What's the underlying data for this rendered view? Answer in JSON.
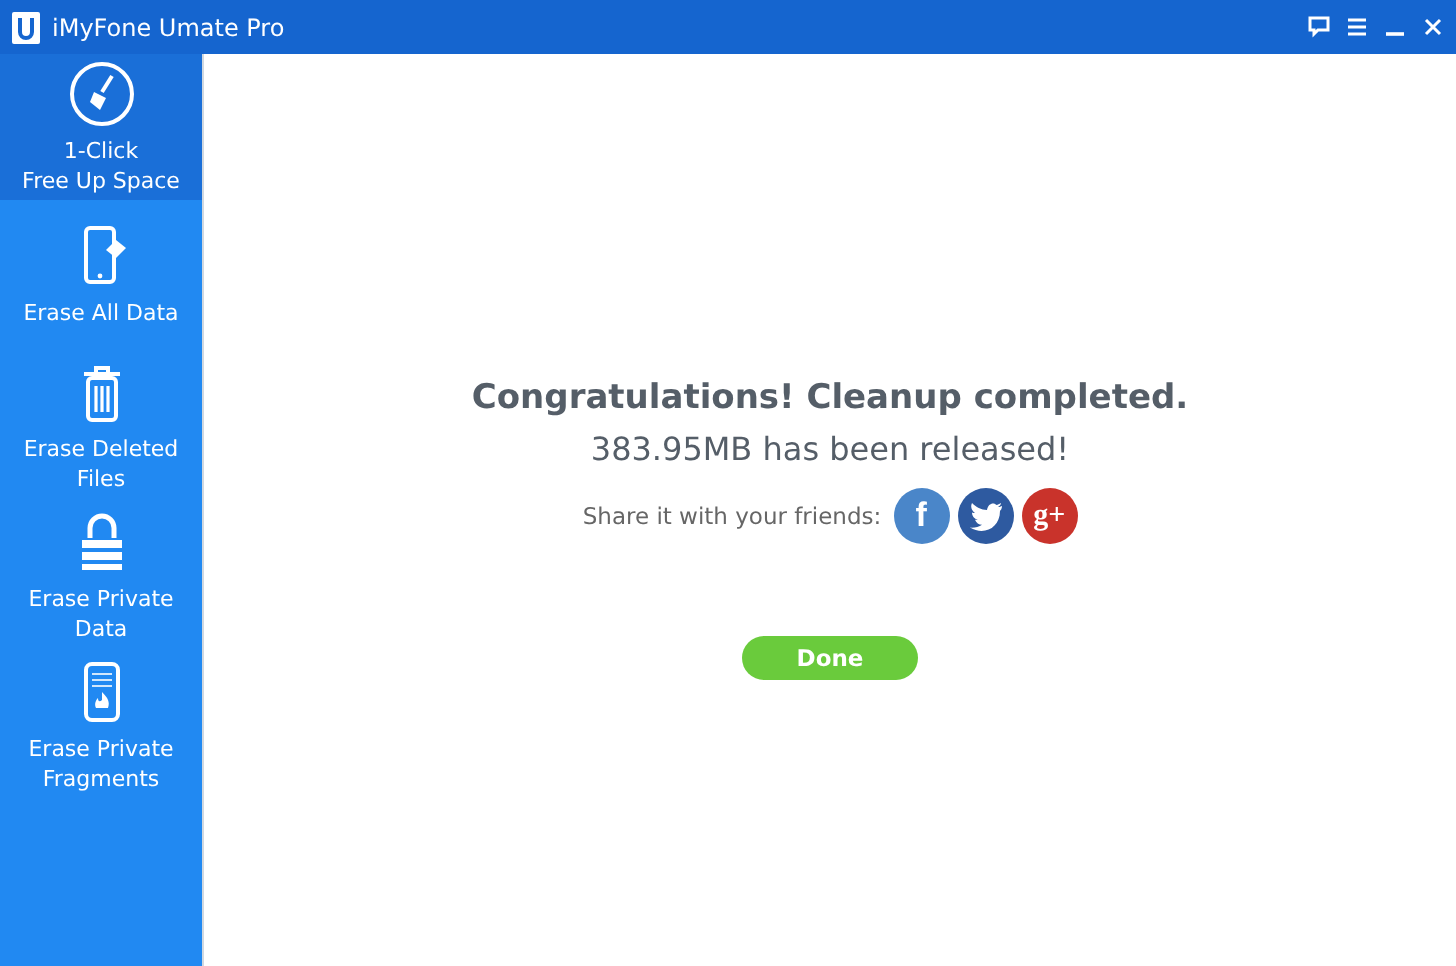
{
  "window": {
    "title": "iMyFone Umate Pro"
  },
  "sidebar": {
    "items": [
      {
        "kind": "broom",
        "lines": [
          "1-Click",
          "Free Up Space"
        ],
        "selected": true
      },
      {
        "kind": "phone-eraser",
        "lines": [
          "Erase All Data"
        ],
        "selected": false
      },
      {
        "kind": "trash",
        "lines": [
          "Erase Deleted",
          "Files"
        ],
        "selected": false
      },
      {
        "kind": "lock",
        "lines": [
          "Erase Private",
          "Data"
        ],
        "selected": false
      },
      {
        "kind": "phone-fire",
        "lines": [
          "Erase Private",
          "Fragments"
        ],
        "selected": false
      }
    ]
  },
  "result": {
    "heading": "Congratulations! Cleanup completed.",
    "detail": "383.95MB has been released!",
    "share_label": "Share it with your friends:",
    "share_buttons": [
      {
        "kind": "facebook",
        "glyph": "f"
      },
      {
        "kind": "twitter"
      },
      {
        "kind": "googleplus",
        "glyph": "g+"
      }
    ],
    "button": "Done"
  }
}
